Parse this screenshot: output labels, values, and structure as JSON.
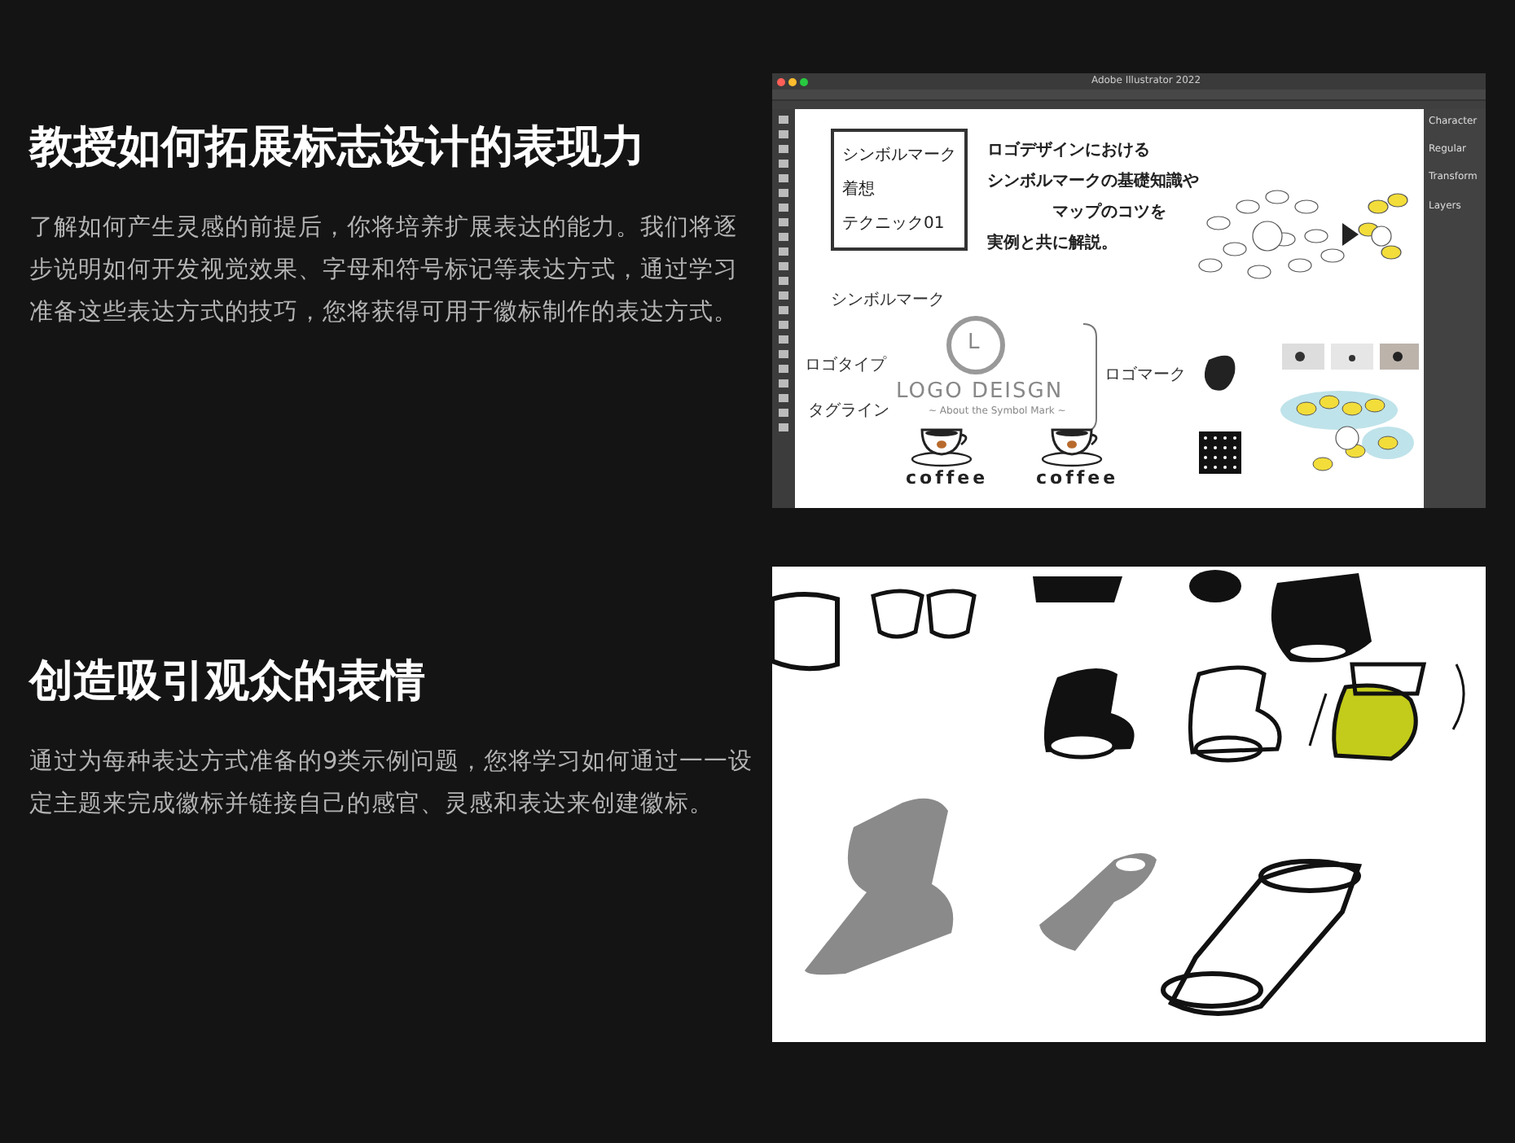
{
  "sections": [
    {
      "heading": "教授如何拓展标志设计的表现力",
      "body": "了解如何产生灵感的前提后，你将培养扩展表达的能力。我们将逐步说明如何开发视觉效果、字母和符号标记等表达方式，通过学习准备这些表达方式的技巧，您将获得可用于徽标制作的表达方式。",
      "figure": {
        "kind": "app_window",
        "title": "Adobe Illustrator 2022",
        "box_lines": [
          "シンボルマーク",
          "着想",
          "テクニック01"
        ],
        "intro_lines": [
          "ロゴデザインにおける",
          "シンボルマークの基礎知識や",
          "マップのコツを",
          "実例と共に解説。"
        ],
        "labels": [
          "シンボルマーク",
          "ロゴタイプ",
          "タグライン",
          "ロゴマーク"
        ],
        "logo_letter": "L",
        "logo_text": "LOGO DEISGN",
        "tagline": "~ About the Symbol Mark ~",
        "cups": [
          "coffee",
          "coffee"
        ],
        "panels": [
          "Character",
          "Regular",
          "Transform",
          "Layers"
        ]
      }
    },
    {
      "heading": "创造吸引观众的表情",
      "body": "通过为每种表达方式准备的9类示例问题，您将学习如何通过一一设定主题来完成徽标并链接自己的感官、灵感和表达来创建徽标。",
      "figure": {
        "kind": "sketch"
      }
    }
  ]
}
